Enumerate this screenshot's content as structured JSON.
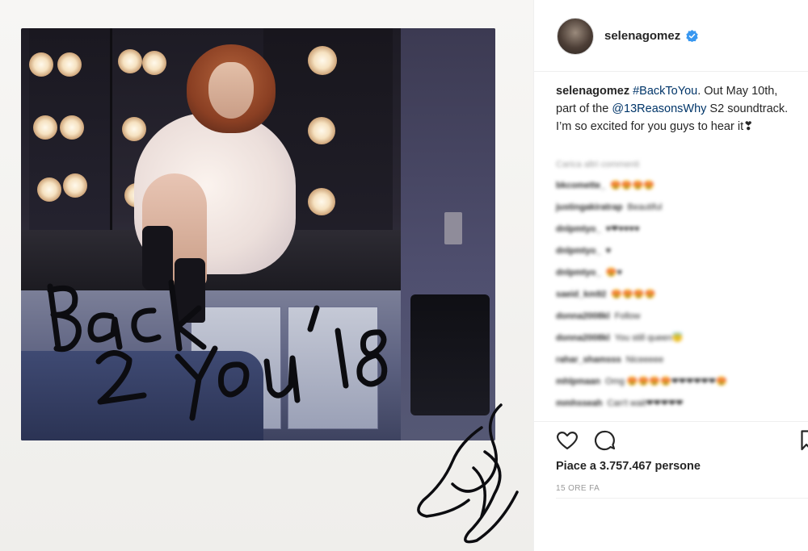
{
  "post": {
    "handwriting_text": [
      "Back",
      "2 You '18"
    ],
    "signature": "Selena"
  },
  "sidebar": {
    "header": {
      "username": "selenagomez",
      "verified": true,
      "verified_color": "#3897f0"
    },
    "caption": {
      "username": "selenagomez",
      "hashtag": "#BackToYou",
      "text_1": ". Out May 10th, part of the ",
      "mention": "@13ReasonsWhy",
      "text_2": " S2 soundtrack. I’m so excited for you guys to hear it❣"
    },
    "comments": {
      "load_more": "Carica altri commenti",
      "items": [
        {
          "user": "bkcomette_",
          "text": "😍😍😍😍"
        },
        {
          "user": "justingakiratrap",
          "text": "Beautiful"
        },
        {
          "user": "dnlpmtyo_",
          "text": "♥❤♥♥♥♥"
        },
        {
          "user": "dnlpmtyo_",
          "text": "♥"
        },
        {
          "user": "dnlpmtyo_",
          "text": "😍♥"
        },
        {
          "user": "saeid_km92",
          "text": "😍😍😍😍"
        },
        {
          "user": "donna2008kl",
          "text": "Follow"
        },
        {
          "user": "donna2008kl",
          "text": "You still queen😇"
        },
        {
          "user": "rahar_shamsss",
          "text": "Niceeeee"
        },
        {
          "user": "mhlpmaan",
          "text": "Omg 😍😍😍😍❤❤❤❤❤❤😍"
        },
        {
          "user": "mmhsseah",
          "text": "Can't wait❤❤❤❤❤"
        }
      ]
    },
    "actions": {
      "like_icon": "heart-icon",
      "comment_icon": "speech-bubble-icon",
      "save_icon": "bookmark-icon",
      "likes": "Piace a 3.757.467 persone",
      "timestamp": "15 ORE FA"
    }
  }
}
